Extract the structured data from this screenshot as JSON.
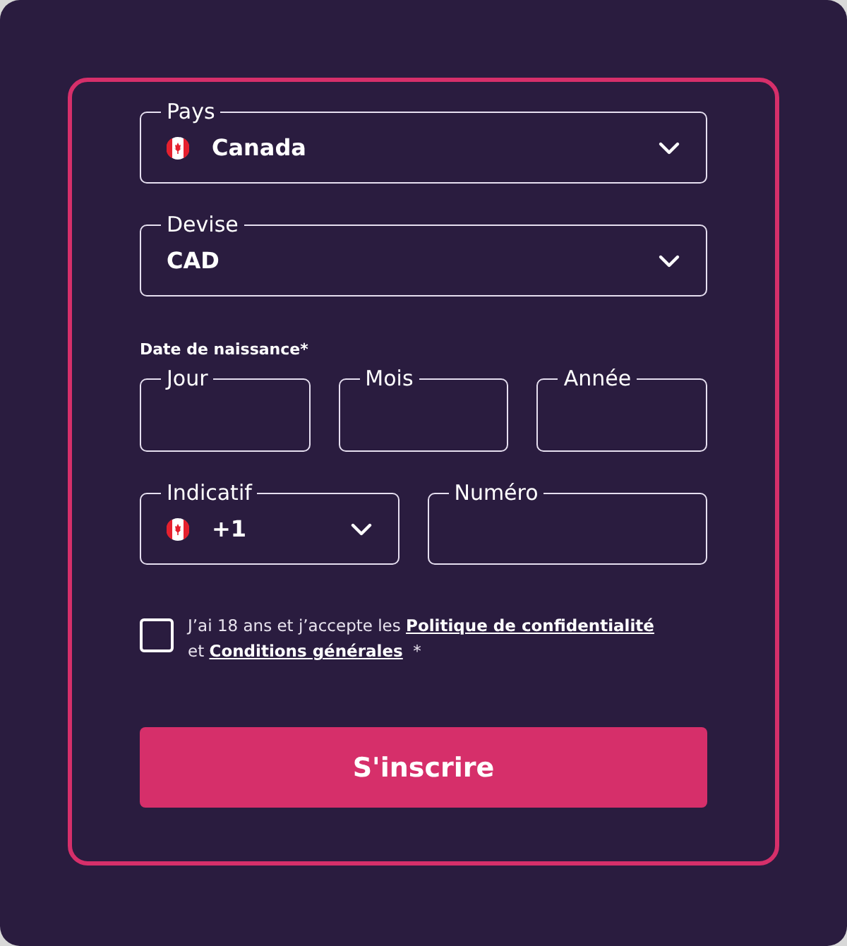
{
  "fields_top": [
    {
      "kind": "select",
      "label": "Pays",
      "value": "Canada",
      "flag": true
    },
    {
      "kind": "select",
      "label": "Devise",
      "value": "CAD",
      "flag": false
    }
  ],
  "birth_date": {
    "label": "Date de naissance*",
    "fields": [
      {
        "label": "Jour"
      },
      {
        "label": "Mois"
      },
      {
        "label": "Année"
      }
    ]
  },
  "phone": [
    {
      "kind": "select",
      "label": "Indicatif",
      "value": "+1",
      "flag": true
    },
    {
      "kind": "input",
      "label": "Numéro"
    }
  ],
  "consent": {
    "checked": false,
    "parts": [
      {
        "kind": "text",
        "text": "J’ai 18 ans et j’accepte les "
      },
      {
        "kind": "link",
        "text": "Politique de confidentialité"
      },
      {
        "kind": "text",
        "text": " et "
      },
      {
        "kind": "link",
        "text": "Conditions générales"
      },
      {
        "kind": "text",
        "text": "  *"
      }
    ]
  },
  "submit": "S'inscrire"
}
